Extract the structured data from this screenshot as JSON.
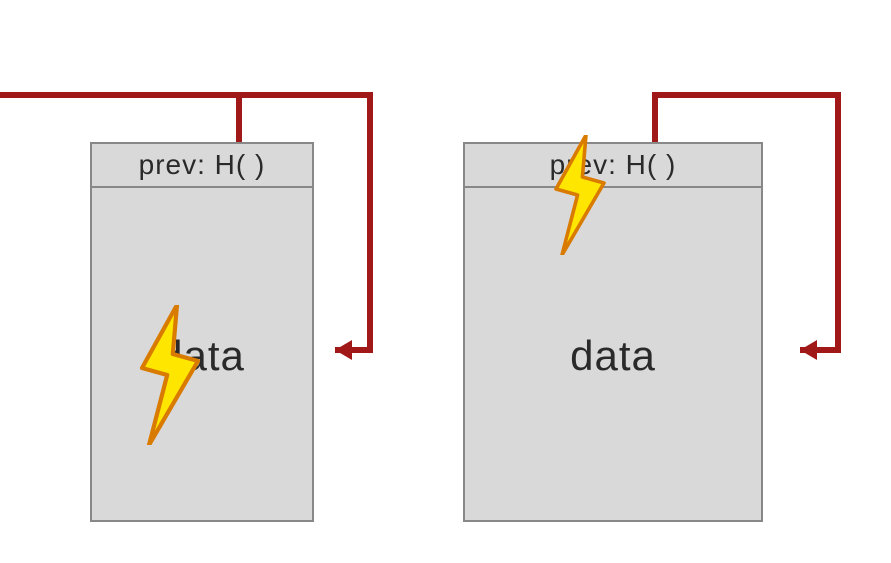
{
  "diagram": {
    "blocks": [
      {
        "header": "prev: H(  )",
        "body": "data"
      },
      {
        "header": "prev: H(  )",
        "body": "data"
      }
    ],
    "colors": {
      "arrow": "#a01818",
      "block_fill": "#d9d9d9",
      "block_border": "#888888",
      "lightning_fill": "#ffe600",
      "lightning_stroke": "#d97b00"
    }
  }
}
